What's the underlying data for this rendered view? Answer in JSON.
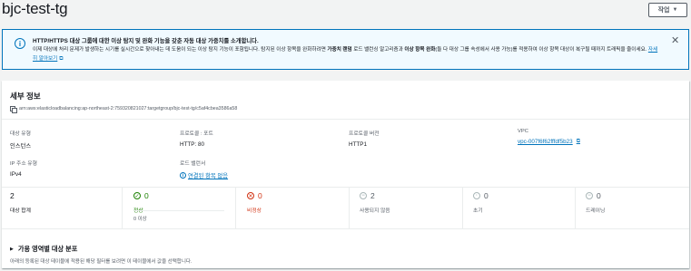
{
  "page": {
    "title": "bjc-test-tg",
    "action_label": "작업"
  },
  "flash": {
    "title": "HTTP/HTTPS 대상 그룹에 대한 이상 탐지 및 완화 기능을 갖춘 자동 대상 가중치를 소개합니다.",
    "body_1": "이제 대상에 처리 문제가 발생하는 시기를 실시간으로 찾아내는 데 도움이 되는 이상 탐지 기능이 포함됩니다. 탐지된 이상 항목을 완화하려면 ",
    "body_bold_1": "가중치 랜덤",
    "body_2": " 로드 밸런싱 알고리즘과 ",
    "body_bold_2": "이상 항목 완화",
    "body_3": "(둘 다 대상 그룹 속성에서 사용 가능)를 적용하여 이상 항목 대상이 복구될 때까지 트래픽을 줄이세요.",
    "link": "자세히 알아보기"
  },
  "details": {
    "title": "세부 정보",
    "arn": "arn:aws:elasticloadbalancing:ap-northeast-2:759320821027:targetgroup/bjc-test-tg/c5af4cbea3586a58",
    "target_type_label": "대상 유형",
    "target_type_value": "인스턴스",
    "protocol_port_label": "프로토콜 : 포트",
    "protocol_port_value": "HTTP: 80",
    "protocol_version_label": "프로토콜 버전",
    "protocol_version_value": "HTTP1",
    "vpc_label": "VPC",
    "vpc_value": "vpc-007f6f62fffdf5b23",
    "ip_type_label": "IP 주소 유형",
    "ip_type_value": "IPv4",
    "lb_label": "로드 밸런서",
    "lb_value": "연결된 항목 없음"
  },
  "stats": {
    "total": {
      "value": "2",
      "label": "대상 합계"
    },
    "healthy": {
      "value": "0",
      "label": "정상",
      "sub": "0 이상"
    },
    "unhealthy": {
      "value": "0",
      "label": "비정상"
    },
    "unused": {
      "value": "2",
      "label": "사용되지 않음"
    },
    "initial": {
      "value": "0",
      "label": "초기"
    },
    "draining": {
      "value": "0",
      "label": "드레이닝"
    }
  },
  "az": {
    "title": "가용 영역별 대상 분포",
    "desc": "아래의 등록된 대상 테이블에 적용된 해당 필터를 보려면 이 테이블에서 값을 선택합니다."
  },
  "colors": {
    "link": "#0073bb",
    "healthy": "#1d8102",
    "unhealthy": "#d13212",
    "neutral": "#aab7b8",
    "flash_bg": "#f1faff"
  }
}
